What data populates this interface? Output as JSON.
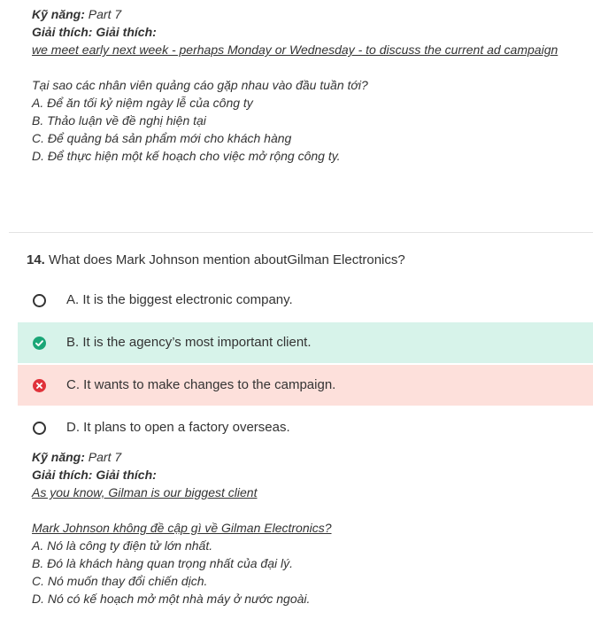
{
  "prev": {
    "skill_label": "Kỹ năng:",
    "skill_value": "Part 7",
    "expl_label": "Giải thích: Giải thích:",
    "evidence": "we meet early next week - perhaps Monday or Wednesday - to discuss the current ad campaign",
    "question_vi": "Tại sao các nhân viên quảng cáo gặp nhau vào đầu tuần tới?",
    "options_vi": [
      "A. Để ăn tối kỷ niệm ngày lễ của công ty",
      "B. Thảo luận về đề nghị hiện tại",
      "C. Để quảng bá sản phẩm mới cho khách hàng",
      "D. Để thực hiện một kế hoạch cho việc mở rộng công ty."
    ]
  },
  "question": {
    "number": "14.",
    "text": "What does Mark Johnson mention aboutGilman Electronics?",
    "options": [
      {
        "label": "A. It is the biggest electronic company.",
        "state": "none"
      },
      {
        "label": "B. It is the agency’s most important client.",
        "state": "correct"
      },
      {
        "label": "C. It wants to make changes to the campaign.",
        "state": "wrong"
      },
      {
        "label": "D. It plans to open a factory overseas.",
        "state": "none"
      }
    ],
    "colors": {
      "correct_bg": "#d7f3ea",
      "correct_icon": "#1aa677",
      "wrong_bg": "#fde0db",
      "wrong_icon": "#e0323a"
    }
  },
  "explanation": {
    "skill_label": "Kỹ năng:",
    "skill_value": "Part 7",
    "expl_label": "Giải thích: Giải thích:",
    "evidence": "As you know, Gilman is our biggest client",
    "question_vi": "Mark Johnson không đề cập gì về Gilman Electronics?",
    "options_vi": [
      "A. Nó là công ty điện tử lớn nhất.",
      "B. Đó là khách hàng quan trọng nhất của đại lý.",
      "C. Nó muốn thay đổi chiến dịch.",
      "D. Nó có kế hoạch mở một nhà máy ở nước ngoài."
    ]
  }
}
